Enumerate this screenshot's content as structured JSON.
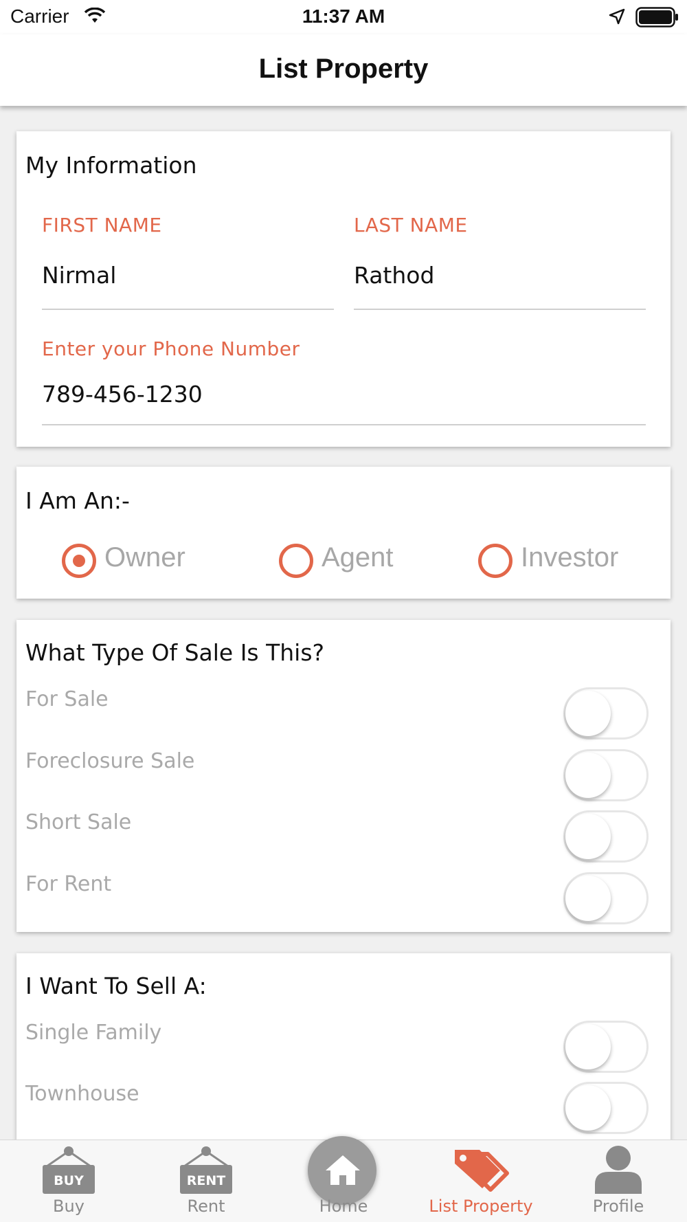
{
  "status_bar": {
    "carrier": "Carrier",
    "time": "11:37 AM"
  },
  "header": {
    "title": "List Property"
  },
  "my_information": {
    "title": "My Information",
    "first_name_label": "FIRST NAME",
    "first_name_value": "Nirmal",
    "last_name_label": "LAST NAME",
    "last_name_value": "Rathod",
    "phone_label": "Enter your Phone Number",
    "phone_value": "789-456-1230"
  },
  "role": {
    "title": "I Am An:-",
    "options": [
      "Owner",
      "Agent",
      "Investor"
    ],
    "selected": "Owner"
  },
  "sale_type": {
    "title": "What Type Of Sale Is This?",
    "options": [
      {
        "label": "For Sale",
        "on": false
      },
      {
        "label": "Foreclosure Sale",
        "on": false
      },
      {
        "label": "Short Sale",
        "on": false
      },
      {
        "label": "For Rent",
        "on": false
      }
    ]
  },
  "property_type": {
    "title": "I Want To Sell A:",
    "options": [
      {
        "label": "Single Family",
        "on": false
      },
      {
        "label": "Townhouse",
        "on": false
      }
    ]
  },
  "tab_bar": {
    "items": [
      {
        "label": "Buy",
        "icon": "buy-sign-icon",
        "sign_text": "BUY",
        "active": false
      },
      {
        "label": "Rent",
        "icon": "rent-sign-icon",
        "sign_text": "RENT",
        "active": false
      },
      {
        "label": "Home",
        "icon": "home-icon",
        "active": false
      },
      {
        "label": "List Property",
        "icon": "price-tags-icon",
        "active": true
      },
      {
        "label": "Profile",
        "icon": "person-icon",
        "active": false
      }
    ]
  },
  "colors": {
    "accent": "#e2674a",
    "inactive": "#8a8a8a",
    "placeholder_text": "#a9a9a9"
  }
}
